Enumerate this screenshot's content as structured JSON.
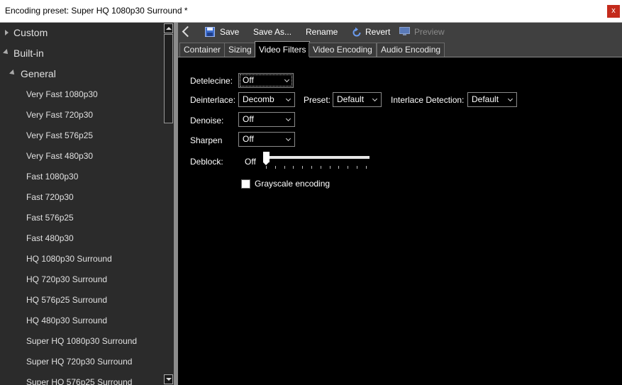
{
  "window": {
    "title": "Encoding preset: Super HQ 1080p30 Surround *",
    "close_label": "x"
  },
  "tree": {
    "custom_label": "Custom",
    "builtin_label": "Built-in",
    "general_label": "General",
    "presets": [
      "Very Fast 1080p30",
      "Very Fast 720p30",
      "Very Fast 576p25",
      "Very Fast 480p30",
      "Fast 1080p30",
      "Fast 720p30",
      "Fast 576p25",
      "Fast 480p30",
      "HQ 1080p30 Surround",
      "HQ 720p30 Surround",
      "HQ 576p25 Surround",
      "HQ 480p30 Surround",
      "Super HQ 1080p30 Surround",
      "Super HQ 720p30 Surround",
      "Super HQ 576p25 Surround"
    ]
  },
  "toolbar": {
    "save": "Save",
    "save_as": "Save As...",
    "rename": "Rename",
    "revert": "Revert",
    "preview": "Preview"
  },
  "tabs": [
    "Container",
    "Sizing",
    "Video Filters",
    "Video Encoding",
    "Audio Encoding"
  ],
  "active_tab": "Video Filters",
  "filters": {
    "detelecine_label": "Detelecine:",
    "detelecine_value": "Off",
    "deinterlace_label": "Deinterlace:",
    "deinterlace_value": "Decomb",
    "preset_label": "Preset:",
    "preset_value": "Default",
    "interlace_detection_label": "Interlace Detection:",
    "interlace_detection_value": "Default",
    "denoise_label": "Denoise:",
    "denoise_value": "Off",
    "sharpen_label": "Sharpen",
    "sharpen_value": "Off",
    "deblock_label": "Deblock:",
    "deblock_value": "Off",
    "deblock_level": 0,
    "grayscale_label": "Grayscale encoding",
    "grayscale_checked": false
  },
  "colors": {
    "accent_blue": "#4a78c8",
    "close_red": "#c42b1c"
  }
}
